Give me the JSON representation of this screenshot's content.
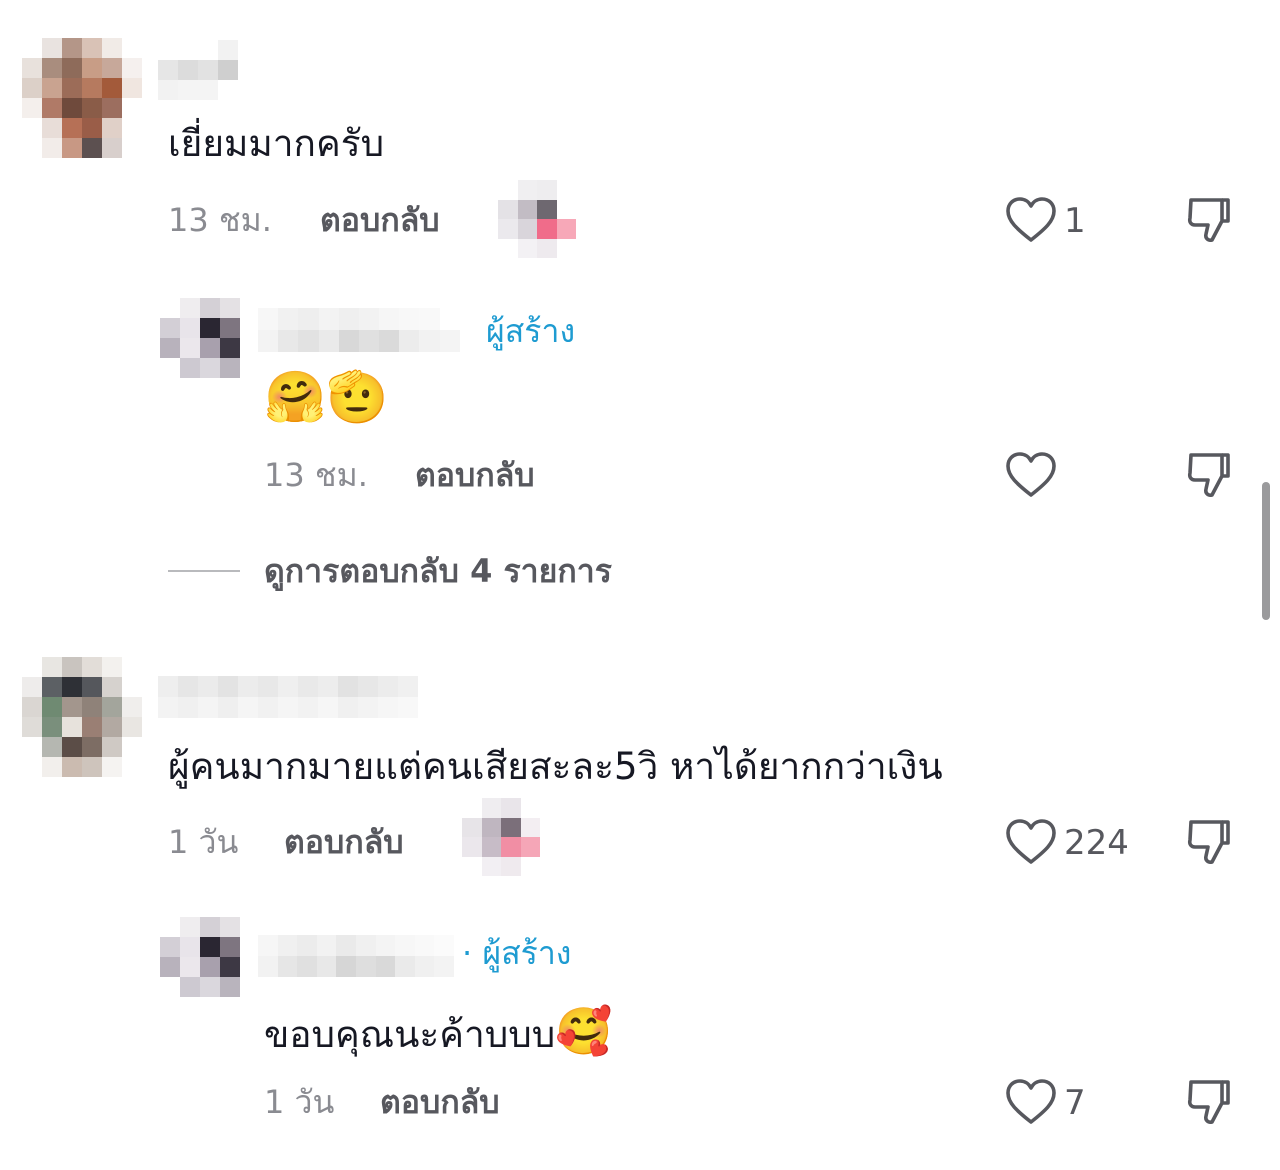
{
  "comments": [
    {
      "text": "เยี่ยมมากครับ",
      "time": "13 ชม.",
      "reply_label": "ตอบกลับ",
      "likes": "1",
      "reply": {
        "creator_label": "ผู้สร้าง",
        "emoji": "🤗🫡",
        "time": "13 ชม.",
        "reply_label": "ตอบกลับ",
        "likes": ""
      }
    },
    {
      "text": "ผู้คนมากมายแต่คนเสียสะละ5วิ หาได้ยากกว่าเงิน",
      "time": "1 วัน",
      "reply_label": "ตอบกลับ",
      "likes": "224",
      "reply": {
        "creator_label": "· ผู้สร้าง",
        "text": "ขอบคุณนะค้าบบบ",
        "emoji": "🥰",
        "time": "1 วัน",
        "reply_label": "ตอบกลับ",
        "likes": "7"
      }
    }
  ],
  "view_replies": "ดูการตอบกลับ 4 รายการ",
  "icons": {
    "like": "heart-outline-icon",
    "dislike": "thumbs-down-icon"
  },
  "colors": {
    "creator": "#1e9bd1",
    "muted": "#8a8b91"
  }
}
